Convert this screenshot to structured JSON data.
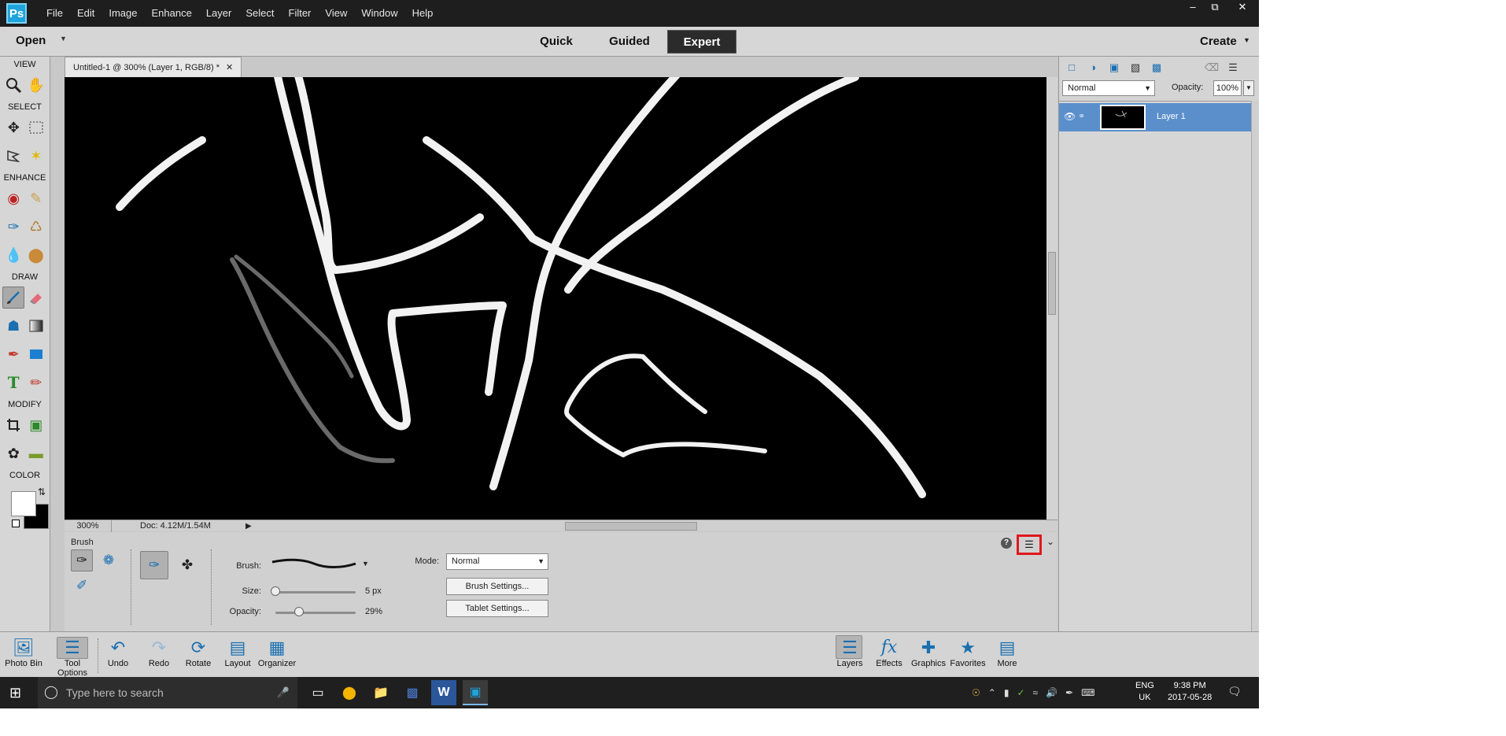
{
  "menubar": {
    "logo_icon": "photoshop-elements-logo",
    "items": [
      "File",
      "Edit",
      "Image",
      "Enhance",
      "Layer",
      "Select",
      "Filter",
      "View",
      "Window",
      "Help"
    ],
    "window_controls": [
      "minimize",
      "restore",
      "close"
    ]
  },
  "modebar": {
    "open_label": "Open",
    "tabs": [
      "Quick",
      "Guided",
      "Expert"
    ],
    "active_tab": "Expert",
    "create_label": "Create"
  },
  "toolbox": {
    "sections": {
      "view": "VIEW",
      "select": "SELECT",
      "enhance": "ENHANCE",
      "draw": "DRAW",
      "modify": "MODIFY",
      "color": "COLOR"
    },
    "active_tool": "brush-tool",
    "foreground_color": "#ffffff",
    "background_color": "#000000"
  },
  "document": {
    "tab_title": "Untitled-1 @ 300% (Layer 1, RGB/8) *",
    "zoom": "300%",
    "doc_info": "Doc: 4.12M/1.54M"
  },
  "tool_options": {
    "title": "Brush",
    "brush_label": "Brush:",
    "size_label": "Size:",
    "size_value": "5 px",
    "size_fraction": 0.0,
    "opacity_label": "Opacity:",
    "opacity_value": "29%",
    "opacity_fraction": 0.29,
    "mode_label": "Mode:",
    "mode_value": "Normal",
    "brush_settings_label": "Brush Settings...",
    "tablet_settings_label": "Tablet Settings...",
    "highlight_color": "#e0181e"
  },
  "layers_panel": {
    "blend_mode": "Normal",
    "opacity_label": "Opacity:",
    "opacity_value": "100%",
    "layers": [
      {
        "name": "Layer 1",
        "visible": true,
        "selected": true
      }
    ],
    "selected_color": "#5b8fcc"
  },
  "bottombar": {
    "left": [
      {
        "label": "Photo Bin",
        "icon": "photo-bin-icon"
      },
      {
        "label": "Tool Options",
        "icon": "tool-options-icon"
      },
      {
        "label": "Undo",
        "icon": "undo-icon"
      },
      {
        "label": "Redo",
        "icon": "redo-icon"
      },
      {
        "label": "Rotate",
        "icon": "rotate-icon"
      },
      {
        "label": "Layout",
        "icon": "layout-icon"
      },
      {
        "label": "Organizer",
        "icon": "organizer-icon"
      }
    ],
    "right": [
      {
        "label": "Layers",
        "icon": "layers-icon"
      },
      {
        "label": "Effects",
        "icon": "fx-icon"
      },
      {
        "label": "Graphics",
        "icon": "graphics-icon"
      },
      {
        "label": "Favorites",
        "icon": "favorites-icon"
      },
      {
        "label": "More",
        "icon": "more-icon"
      }
    ]
  },
  "taskbar": {
    "search_placeholder": "Type here to search",
    "lang_line1": "ENG",
    "lang_line2": "UK",
    "time": "9:38 PM",
    "date": "2017-05-28"
  }
}
